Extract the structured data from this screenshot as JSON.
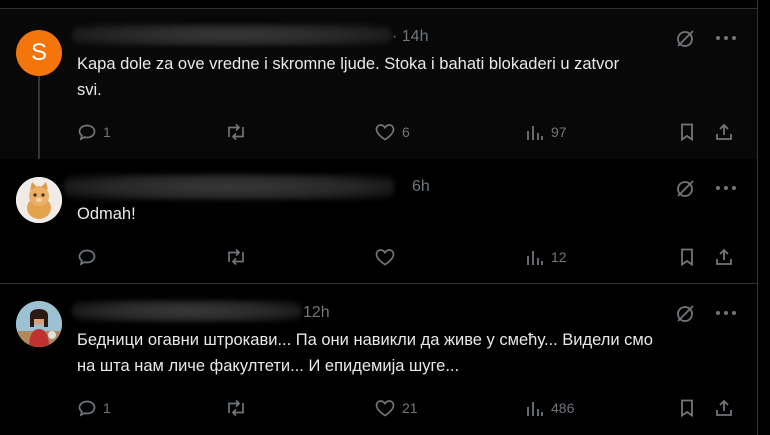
{
  "posts": [
    {
      "avatar_letter": "S",
      "time": "· 14h",
      "text": "Kapa dole za ove vredne i skromne ljude. Stoka i bahati blokaderi u zatvor\nsvi.",
      "replies": "1",
      "reposts": "",
      "likes": "6",
      "views": "97"
    },
    {
      "avatar_letter": "",
      "time": "6h",
      "text": "Odmah!",
      "replies": "",
      "reposts": "",
      "likes": "",
      "views": "12"
    },
    {
      "avatar_letter": "",
      "time": "12h",
      "text": "Бедници огавни штрокави... Па они навикли да живе у смећу... Видели смо\nна шта нам личе факултети... И епидемија шуге...",
      "replies": "1",
      "reposts": "",
      "likes": "21",
      "views": "486"
    }
  ],
  "icons": {
    "reply": "speech-bubble-icon",
    "repost": "repost-arrows-icon",
    "like": "heart-icon",
    "views": "bar-chart-icon",
    "bookmark": "bookmark-icon",
    "share": "share-icon",
    "grok": "grok-icon",
    "more": "more-dots-icon"
  },
  "colors": {
    "background": "#000000",
    "text": "#e7e9ea",
    "muted": "#71767b",
    "avatar_s": "#f4750b"
  }
}
